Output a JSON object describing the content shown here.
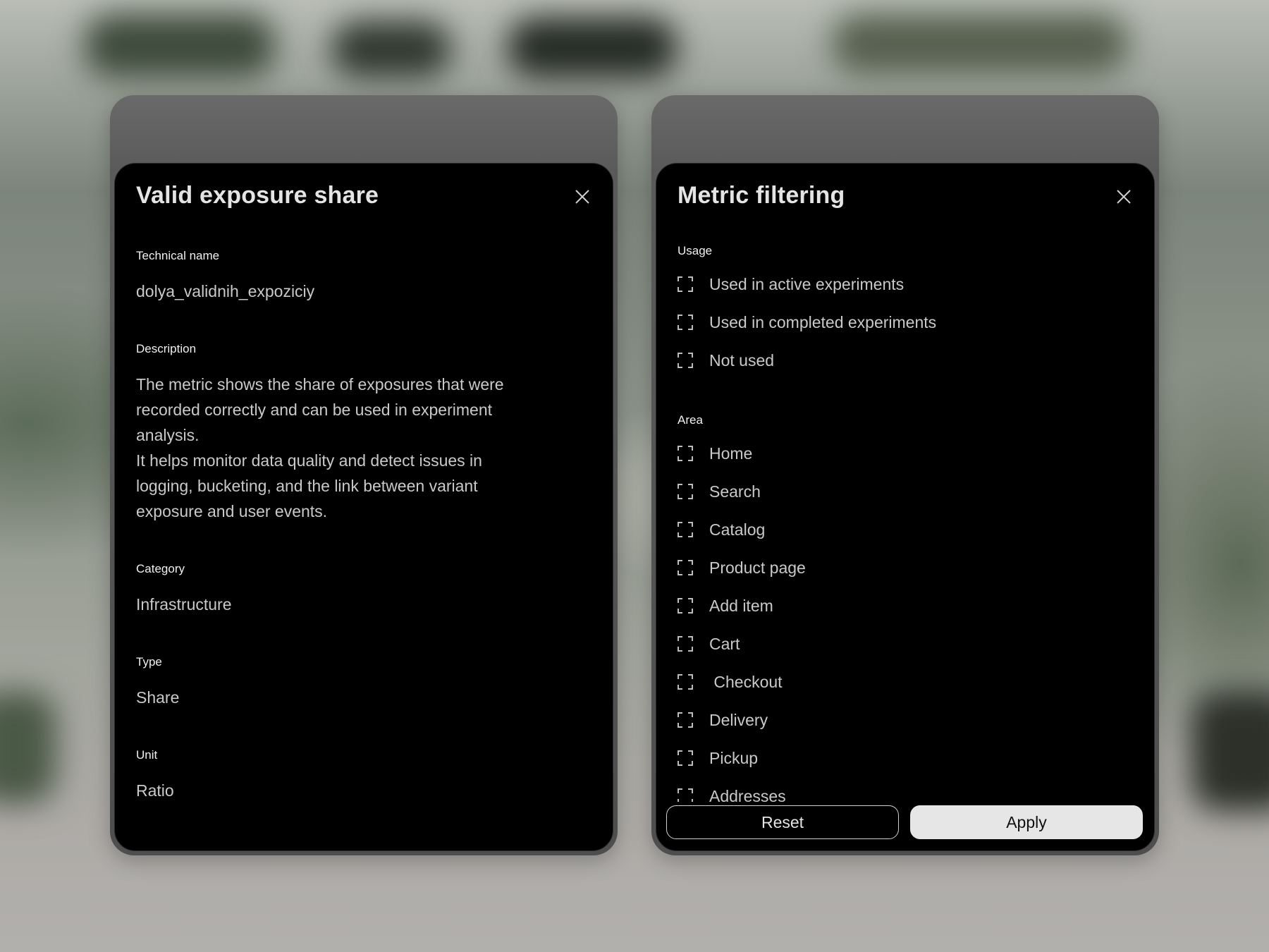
{
  "detail_panel": {
    "title": "Valid exposure share",
    "fields": [
      {
        "label": "Technical name",
        "value": "dolya_validnih_expoziciy"
      },
      {
        "label": "Description",
        "value": "The metric shows the share of exposures that were recorded correctly and can be used in experiment analysis.\nIt helps monitor data quality and detect issues in logging, bucketing, and the link between variant exposure and user events."
      },
      {
        "label": "Category",
        "value": "Infrastructure"
      },
      {
        "label": "Type",
        "value": "Share"
      },
      {
        "label": "Unit",
        "value": "Ratio"
      }
    ],
    "close_icon": "close-icon"
  },
  "filter_panel": {
    "title": "Metric filtering",
    "close_icon": "close-icon",
    "usage": {
      "label": "Usage",
      "options": [
        "Used in active experiments",
        "Used in completed experiments",
        "Not used"
      ]
    },
    "area": {
      "label": "Area",
      "options": [
        "Home",
        "Search",
        "Catalog",
        "Product page",
        "Add item",
        "Cart",
        " Checkout",
        "Delivery",
        "Pickup",
        "Addresses"
      ]
    },
    "reset_label": "Reset",
    "apply_label": "Apply"
  },
  "colors": {
    "card_bg": "#000000",
    "text_primary": "#e4e4e4",
    "text_secondary": "#c9c9c9",
    "apply_bg": "#e6e6e6"
  }
}
